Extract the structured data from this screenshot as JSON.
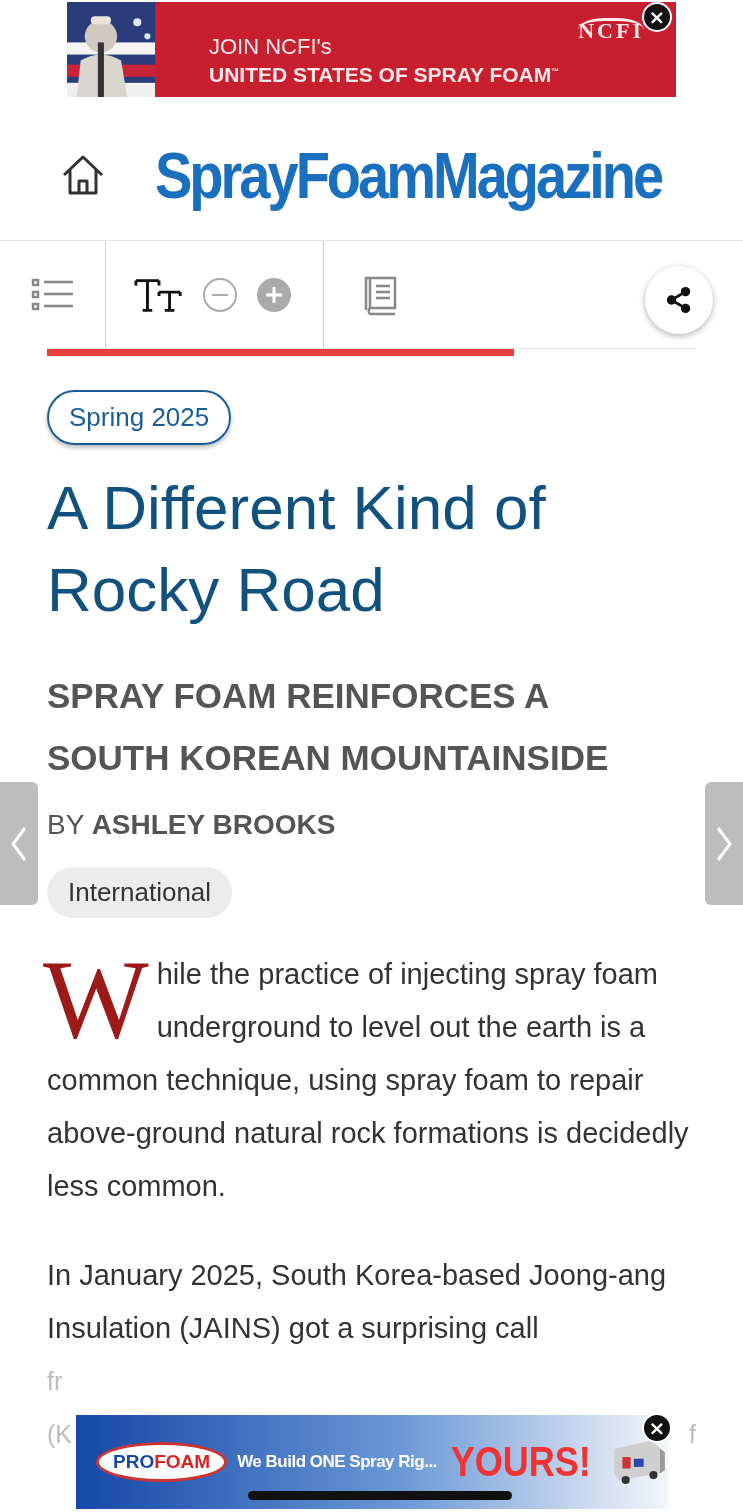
{
  "top_ad": {
    "line_1": "JOIN NCFI's",
    "line_2": "UNITED STATES OF SPRAY FOAM",
    "trademark": "™",
    "logo": "NCFI",
    "close": "×"
  },
  "header": {
    "logo": "SprayFoamMagazine"
  },
  "toolbar": {
    "progress": {
      "level": 0.72
    }
  },
  "issue": "Spring 2025",
  "title": "A Different Kind of Rocky Road",
  "subtitle": "SPRAY FOAM REINFORCES A SOUTH KOREAN MOUNTAINSIDE",
  "byline": "BY **ASHLEY BROOKS**",
  "category": "International",
  "paragraphs": [
    "While the practice of injecting spray foam underground to level out the earth is a common technique, using spray foam to repair above-ground natural rock formations is decidedly less common.",
    "In January 2025, South Korea-based Joong-ang Insulation (JAINS) got a surprising call"
  ],
  "hidden_lines": [
    {
      "left": "fr"
    },
    {
      "left": "(K",
      "right": "f"
    }
  ],
  "bottom_ad": {
    "logo_1": "PRO",
    "logo_2": "FOAM",
    "tagline": "We Build ONE Spray Rig...",
    "headline": "YOURS!",
    "close": "×"
  }
}
